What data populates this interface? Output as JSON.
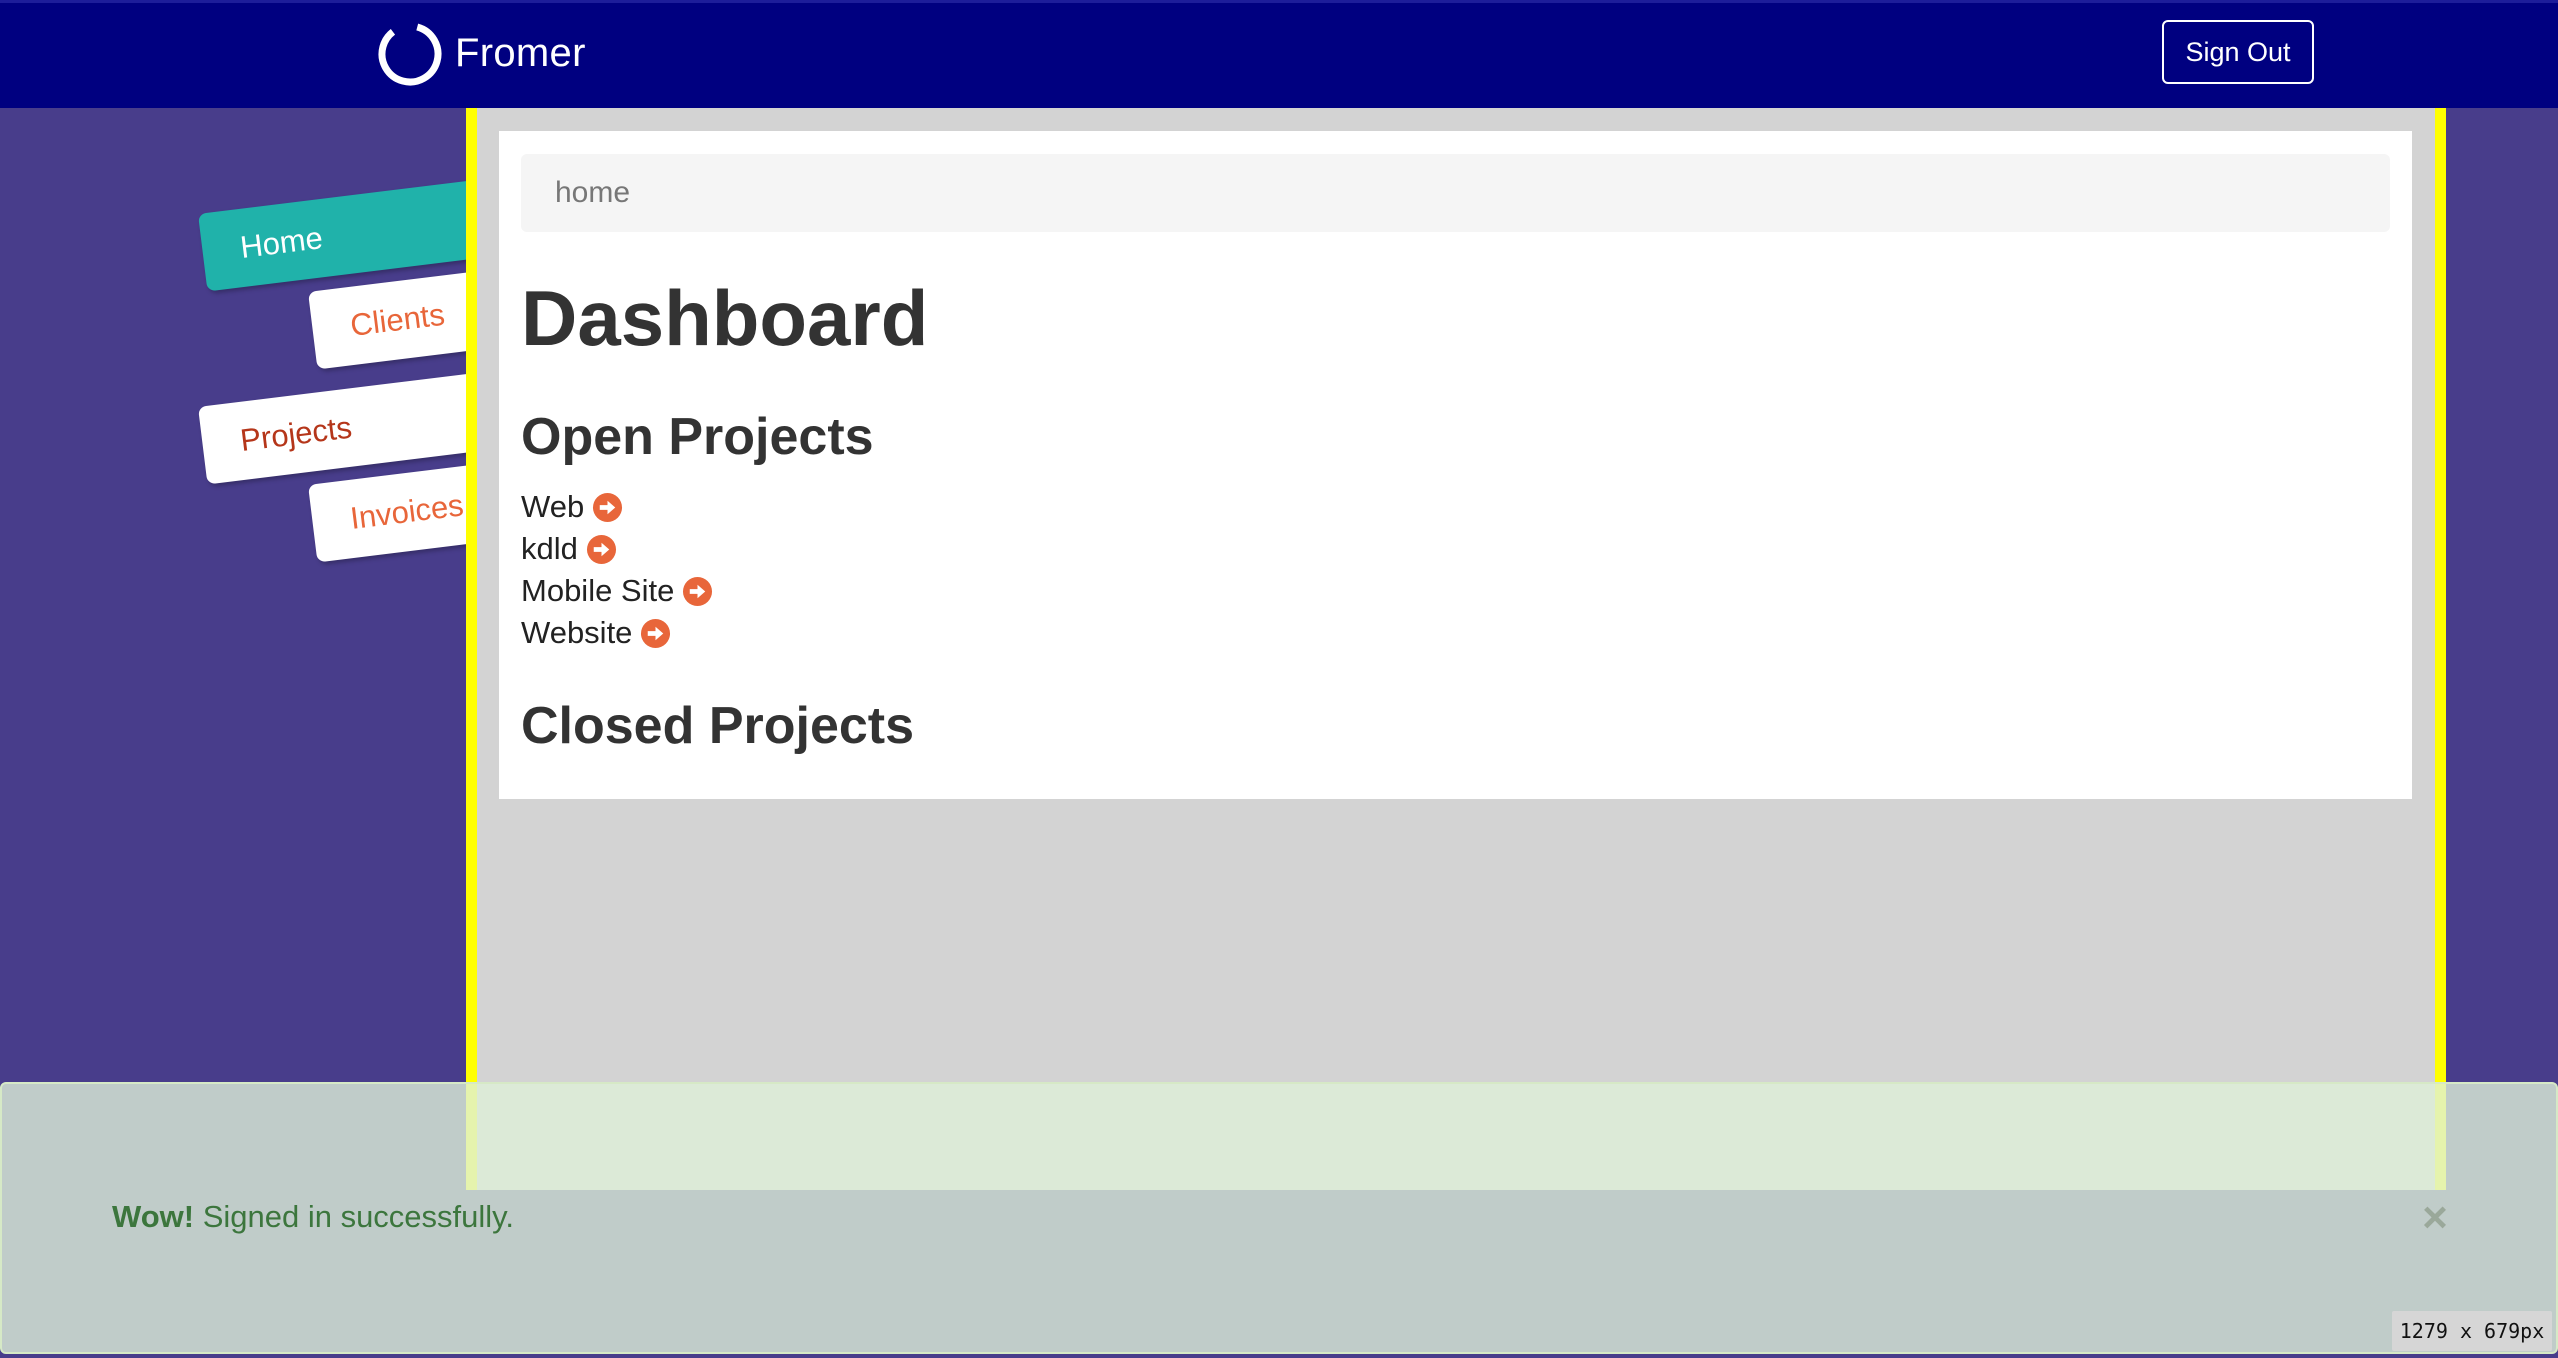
{
  "header": {
    "brand_name": "Fromer",
    "logo_icon": "ring-logo-icon",
    "sign_out_label": "Sign Out"
  },
  "sidebar": {
    "tabs": [
      {
        "label": "Home",
        "active": true
      },
      {
        "label": "Clients",
        "active": false
      },
      {
        "label": "Projects",
        "active": false
      },
      {
        "label": "Invoices",
        "active": false
      }
    ]
  },
  "main": {
    "breadcrumb": "home",
    "title": "Dashboard",
    "open_projects_heading": "Open Projects",
    "open_projects": [
      {
        "name": "Web",
        "icon": "arrow-right-circle-icon"
      },
      {
        "name": "kdld",
        "icon": "arrow-right-circle-icon"
      },
      {
        "name": "Mobile Site",
        "icon": "arrow-right-circle-icon"
      },
      {
        "name": "Website",
        "icon": "arrow-right-circle-icon"
      }
    ],
    "closed_projects_heading": "Closed Projects"
  },
  "alert": {
    "strong": "Wow!",
    "message": " Signed in successfully.",
    "close": "×"
  },
  "viewport_readout": "1279 x 679px",
  "colors": {
    "navbar": "#000080",
    "background": "#483d8b",
    "frame_border": "#ffff00",
    "active_tab": "#20b2aa",
    "accent_orange": "#e8663a",
    "alert_text": "#3c763d"
  }
}
